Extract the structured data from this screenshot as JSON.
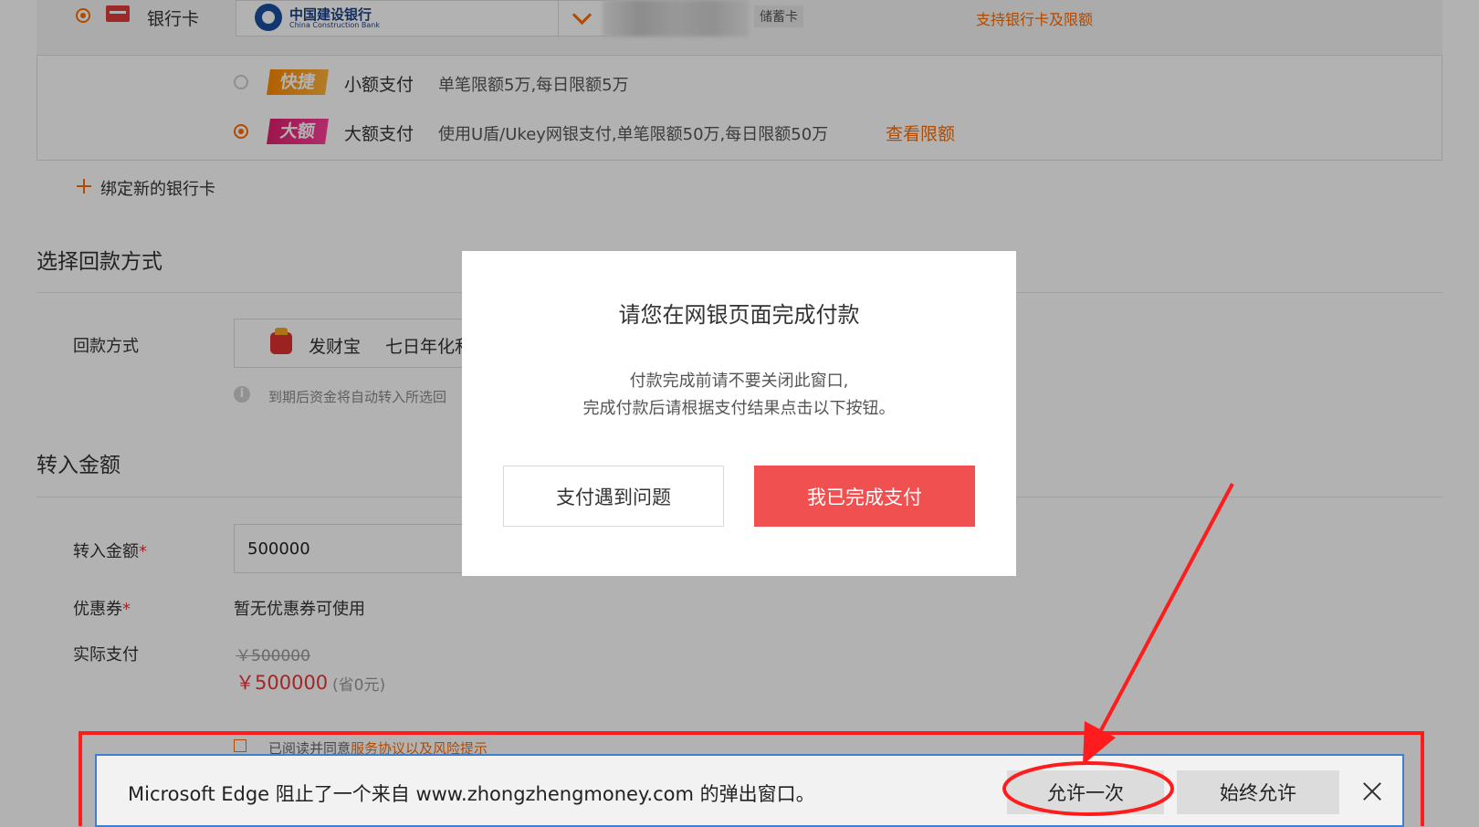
{
  "bank": {
    "method_label": "银行卡",
    "bank_name_cn": "中国建设银行",
    "bank_name_en": "China Construction Bank",
    "card_type": "储蓄卡",
    "support_link": "支持银行卡及限额"
  },
  "payment_options": [
    {
      "badge": "快捷",
      "name": "小额支付",
      "desc": "单笔限额5万,每日限额5万",
      "selected": false
    },
    {
      "badge": "大额",
      "name": "大额支付",
      "desc": "使用U盾/Ukey网银支付,单笔限额50万,每日限额50万",
      "link": "查看限额",
      "selected": true
    }
  ],
  "bind_new_card": "绑定新的银行卡",
  "return_section": {
    "title": "选择回款方式",
    "label": "回款方式",
    "product": "发财宝",
    "product_desc": "七日年化和",
    "hint": "到期后资金将自动转入所选回"
  },
  "amount_section": {
    "title": "转入金额",
    "amount_label": "转入金额",
    "amount_value": "500000",
    "coupon_label": "优惠券",
    "coupon_value": "暂无优惠券可使用",
    "actual_label": "实际支付",
    "original_price": "￥500000",
    "final_price": "￥500000",
    "saved": "(省0元)",
    "agreement_prefix": "已阅读并同意",
    "agreement_link": "服务协议以及风险提示"
  },
  "modal": {
    "title": "请您在网银页面完成付款",
    "line1": "付款完成前请不要关闭此窗口,",
    "line2": "完成付款后请根据支付结果点击以下按钮。",
    "btn_problem": "支付遇到问题",
    "btn_done": "我已完成支付"
  },
  "edge_bar": {
    "message": "Microsoft Edge 阻止了一个来自 www.zhongzhengmoney.com 的弹出窗口。",
    "allow_once": "允许一次",
    "always_allow": "始终允许"
  },
  "colors": {
    "accent_orange": "#ff6a00",
    "primary_red": "#f05050",
    "annotation_red": "#ff1c1c",
    "edge_blue_border": "#3e7fd0"
  }
}
